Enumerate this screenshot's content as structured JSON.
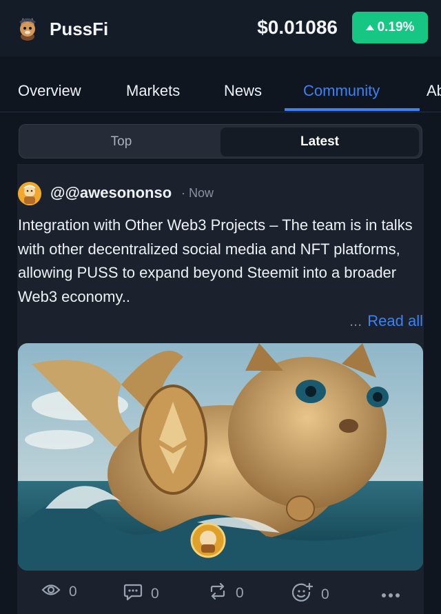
{
  "header": {
    "app_name": "PussFi",
    "price": "$0.01086",
    "change": "0.19%",
    "change_direction": "up",
    "change_color": "#16c784"
  },
  "tabs": [
    {
      "label": "Overview",
      "active": false
    },
    {
      "label": "Markets",
      "active": false
    },
    {
      "label": "News",
      "active": false
    },
    {
      "label": "Community",
      "active": true
    },
    {
      "label": "Ab",
      "active": false
    }
  ],
  "segment": {
    "top_label": "Top",
    "latest_label": "Latest",
    "selected": "Latest"
  },
  "post": {
    "username": "@@awesononso",
    "time": "· Now",
    "text": "Integration with Other Web3 Projects – The team is in talks with other decentralized social media and NFT platforms, allowing PUSS to expand beyond Steemit into a broader Web3 economy..",
    "read_more_prefix": "...",
    "read_more_label": "Read all",
    "stats": {
      "views": "0",
      "comments": "0",
      "reposts": "0",
      "reactions": "0"
    }
  },
  "icons": {
    "logo": "cat-logo-icon",
    "views": "eye-icon",
    "comments": "comment-icon",
    "reposts": "repost-icon",
    "reactions": "add-reaction-icon",
    "more": "more-dots-icon"
  },
  "colors": {
    "accent": "#3b82f6",
    "up": "#16c784",
    "background": "#0f1620"
  }
}
